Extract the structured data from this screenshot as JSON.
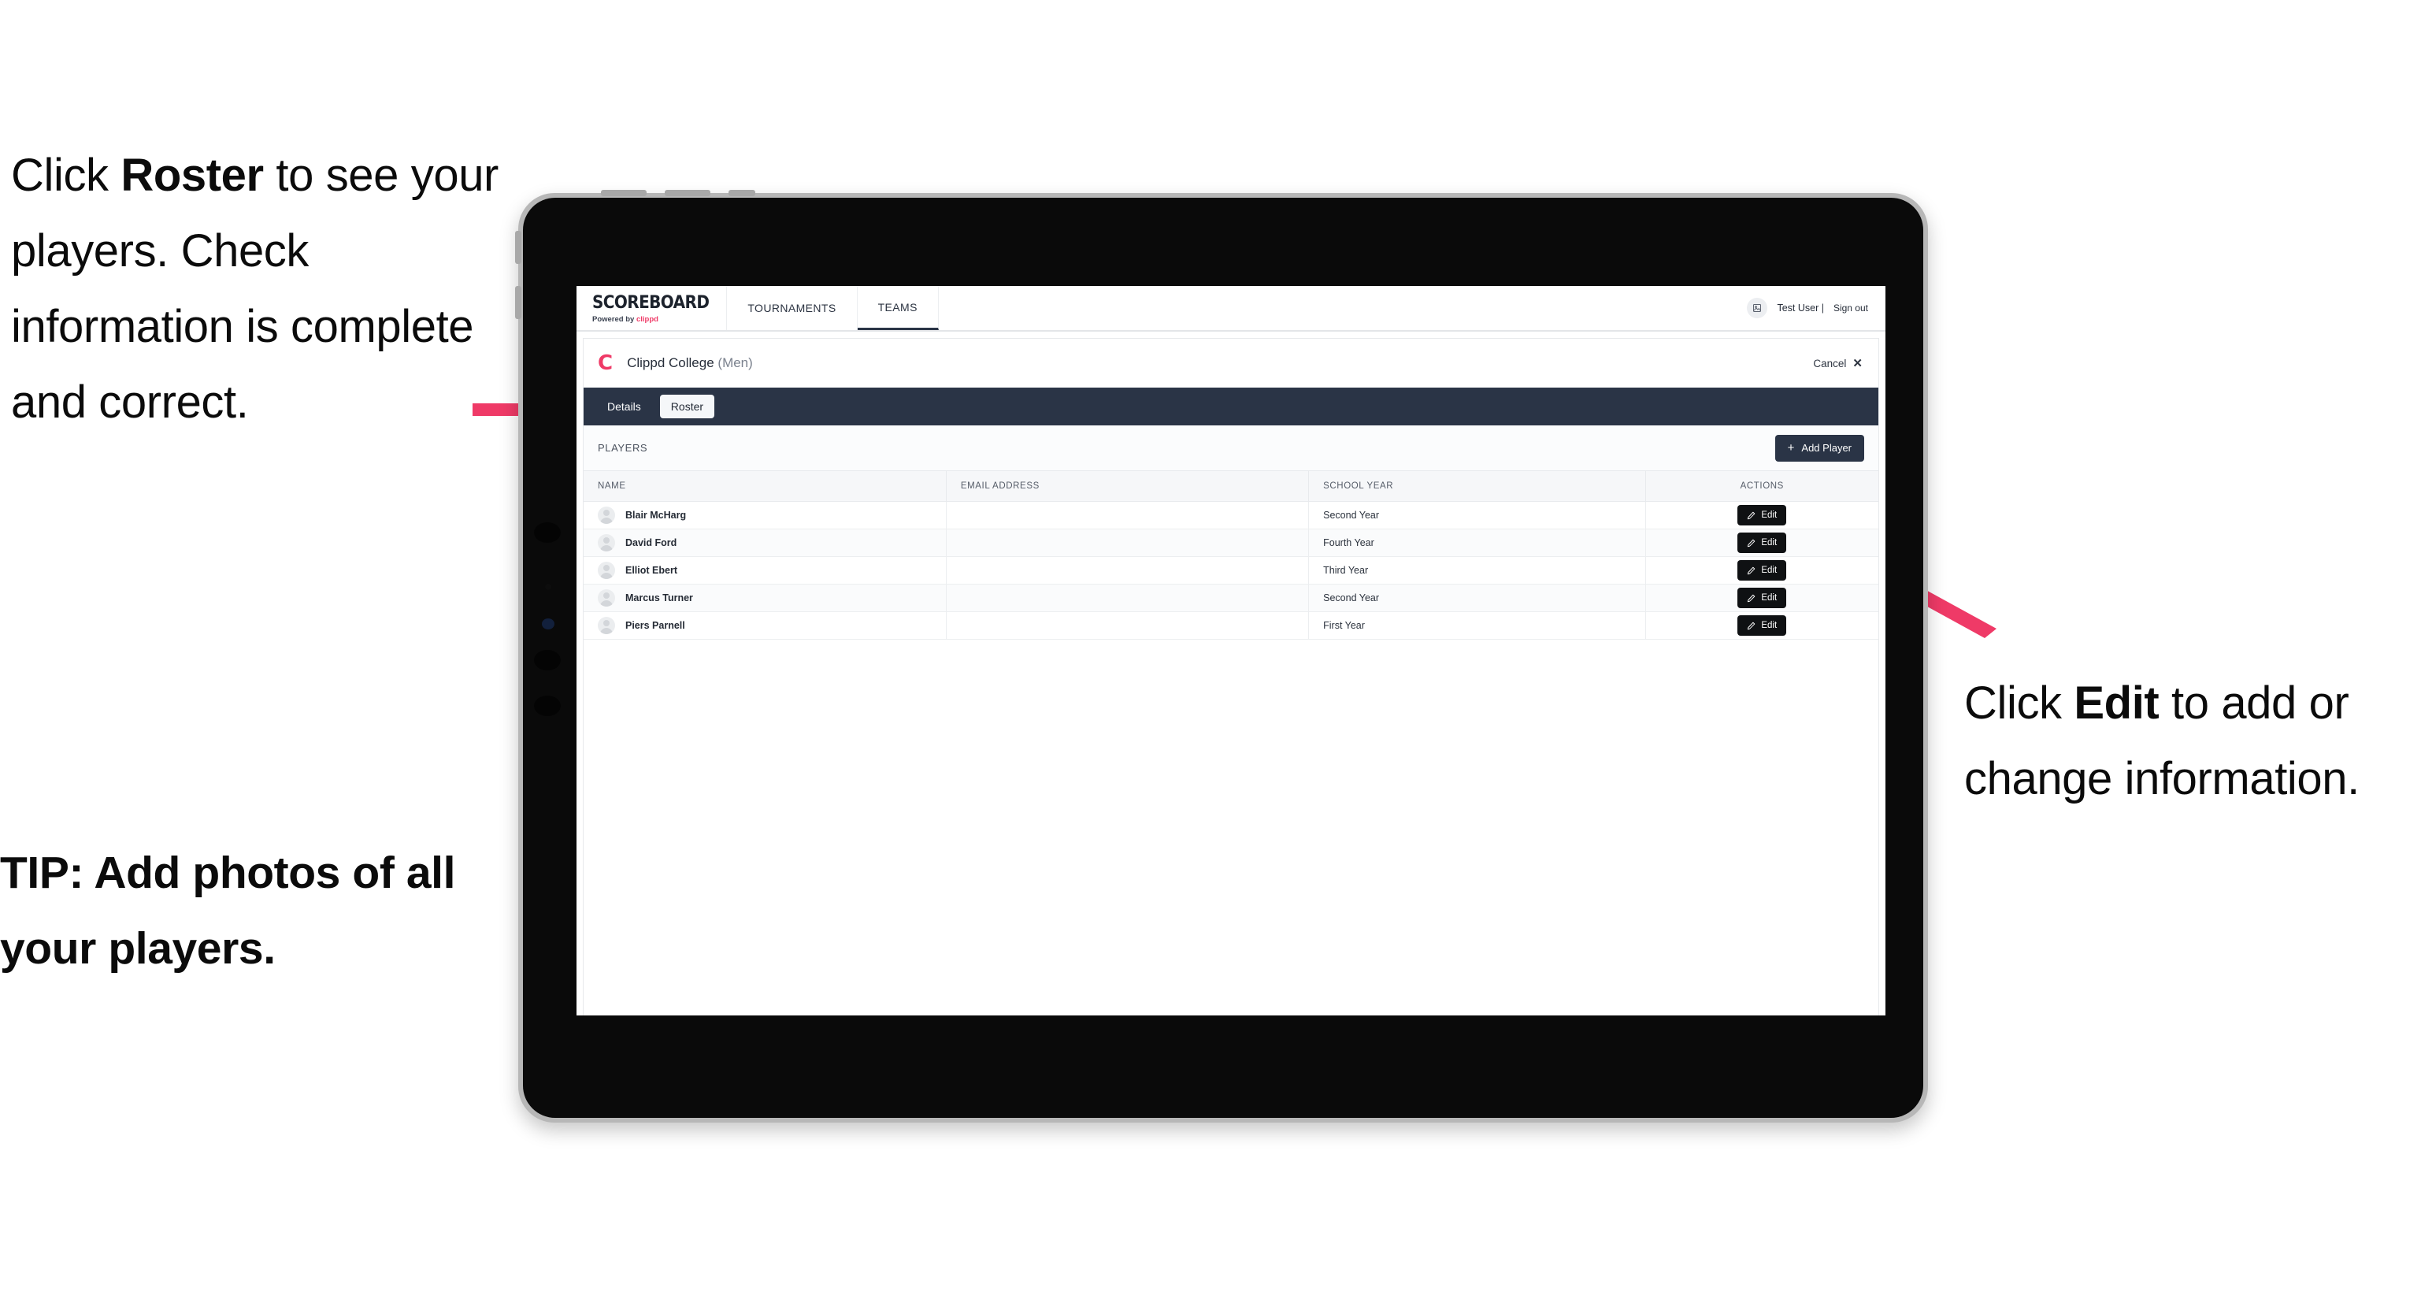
{
  "annotations": {
    "left_prefix": "Click ",
    "left_bold": "Roster",
    "left_suffix": " to see your players. Check information is complete and correct.",
    "tip": "TIP: Add photos of all your players.",
    "right_prefix": "Click ",
    "right_bold": "Edit",
    "right_suffix": " to add or change information."
  },
  "colors": {
    "accent_pink": "#ef3a67",
    "navy": "#2a3446",
    "edit_black": "#0f1113",
    "frame_silver": "#b7b7b7"
  },
  "app": {
    "brand": {
      "title": "SCOREBOARD",
      "powered_prefix": "Powered by ",
      "powered_name": "clippd"
    },
    "nav_tabs": [
      {
        "label": "TOURNAMENTS",
        "active": false
      },
      {
        "label": "TEAMS",
        "active": true
      }
    ],
    "user": {
      "name": "Test User |",
      "sign_out": "Sign out",
      "avatar_icon": "user-avatar-icon"
    },
    "team": {
      "logo_letter": "C",
      "name": "Clippd College",
      "gender": "(Men)",
      "cancel_label": "Cancel",
      "cancel_icon": "close-icon"
    },
    "sub_tabs": [
      {
        "label": "Details",
        "active": false
      },
      {
        "label": "Roster",
        "active": true
      }
    ],
    "players_section": {
      "label": "PLAYERS",
      "add_button": {
        "label": "Add Player",
        "icon": "plus-icon"
      },
      "columns": [
        "NAME",
        "EMAIL ADDRESS",
        "SCHOOL YEAR",
        "ACTIONS"
      ],
      "action_label": "Edit",
      "action_icon": "pencil-icon",
      "rows": [
        {
          "name": "Blair McHarg",
          "email": "",
          "school_year": "Second Year"
        },
        {
          "name": "David Ford",
          "email": "",
          "school_year": "Fourth Year"
        },
        {
          "name": "Elliot Ebert",
          "email": "",
          "school_year": "Third Year"
        },
        {
          "name": "Marcus Turner",
          "email": "",
          "school_year": "Second Year"
        },
        {
          "name": "Piers Parnell",
          "email": "",
          "school_year": "First Year"
        }
      ]
    }
  }
}
